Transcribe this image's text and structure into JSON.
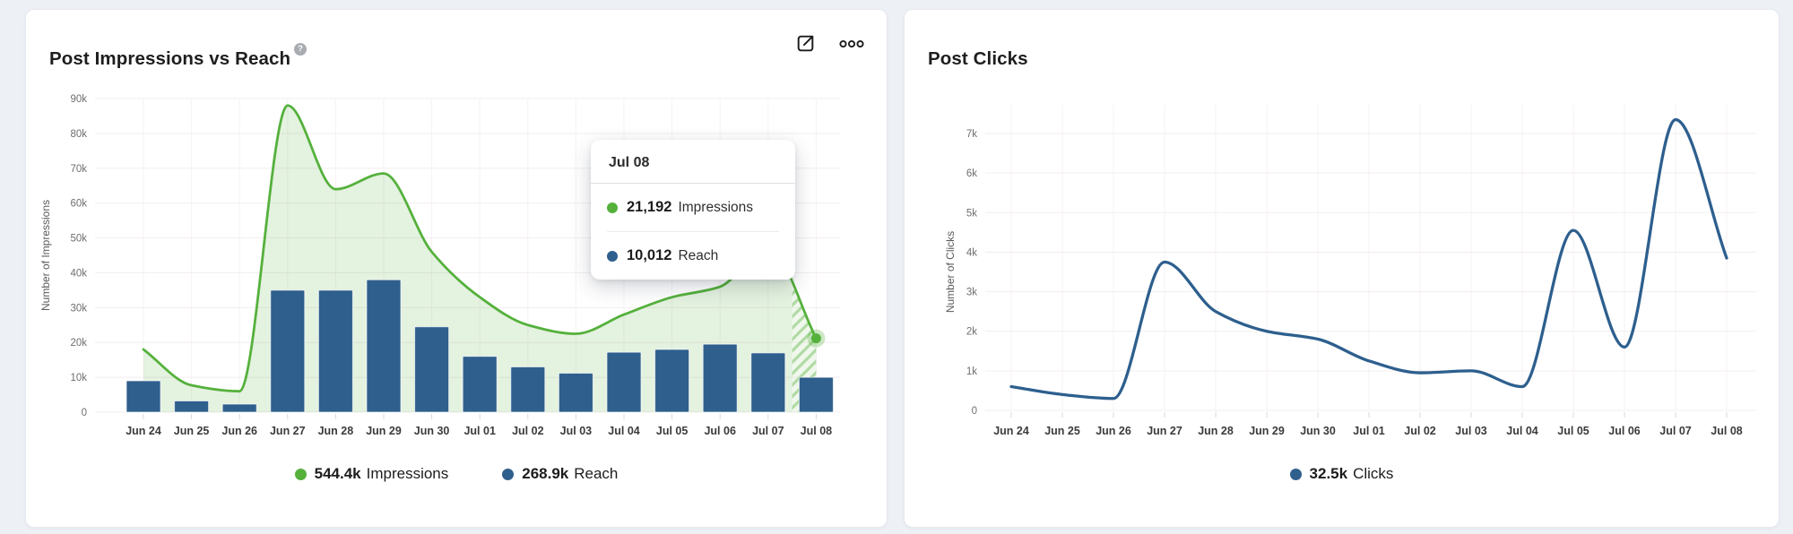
{
  "cards": {
    "impressions_reach": {
      "title": "Post Impressions vs Reach",
      "help_icon": "?",
      "legend": [
        {
          "color": "#55b13c",
          "value": "544.4k",
          "label": "Impressions"
        },
        {
          "color": "#2f5f8d",
          "value": "268.9k",
          "label": "Reach"
        }
      ],
      "tooltip": {
        "title": "Jul 08",
        "rows": [
          {
            "color": "#55b13c",
            "value": "21,192",
            "label": "Impressions"
          },
          {
            "color": "#2f5f8d",
            "value": "10,012",
            "label": "Reach"
          }
        ]
      }
    },
    "clicks": {
      "title": "Post Clicks",
      "legend": [
        {
          "color": "#2f5f8d",
          "value": "32.5k",
          "label": "Clicks"
        }
      ]
    }
  },
  "chart_data": [
    {
      "type": "area",
      "title": "Post Impressions vs Reach",
      "categories": [
        "Jun 24",
        "Jun 25",
        "Jun 26",
        "Jun 27",
        "Jun 28",
        "Jun 29",
        "Jun 30",
        "Jul 01",
        "Jul 02",
        "Jul 03",
        "Jul 04",
        "Jul 05",
        "Jul 06",
        "Jul 07",
        "Jul 08"
      ],
      "series": [
        {
          "name": "Impressions",
          "type": "area-line",
          "color": "#55b13c",
          "values": [
            18000,
            7700,
            6000,
            88000,
            64000,
            68500,
            46000,
            33000,
            25000,
            22500,
            28000,
            33000,
            36000,
            47500,
            21192
          ],
          "total": "544.4k",
          "last_point_marker": true,
          "last_segment_hatched": true
        },
        {
          "name": "Reach",
          "type": "bar",
          "color": "#2f5f8d",
          "values": [
            9000,
            3200,
            2300,
            35000,
            35000,
            38000,
            24500,
            16000,
            13000,
            11200,
            17200,
            18000,
            19500,
            17000,
            10012
          ],
          "total": "268.9k"
        }
      ],
      "xlabel": "",
      "ylabel": "Number of Impressions",
      "ylim": [
        0,
        90000
      ],
      "ytick_step": 10000,
      "ytick_labels": [
        "0",
        "10k",
        "20k",
        "30k",
        "40k",
        "50k",
        "60k",
        "70k",
        "80k",
        "90k"
      ],
      "grid": true,
      "legend_position": "bottom",
      "tooltip_point": {
        "category": "Jul 08",
        "Impressions": 21192,
        "Reach": 10012
      }
    },
    {
      "type": "line",
      "title": "Post Clicks",
      "categories": [
        "Jun 24",
        "Jun 25",
        "Jun 26",
        "Jun 27",
        "Jun 28",
        "Jun 29",
        "Jun 30",
        "Jul 01",
        "Jul 02",
        "Jul 03",
        "Jul 04",
        "Jul 05",
        "Jul 06",
        "Jul 07",
        "Jul 08"
      ],
      "series": [
        {
          "name": "Clicks",
          "type": "line",
          "color": "#2d5f8e",
          "values": [
            600,
            400,
            300,
            3750,
            2500,
            2000,
            1800,
            1250,
            950,
            1000,
            600,
            4550,
            1600,
            7350,
            3850
          ],
          "total": "32.5k"
        }
      ],
      "xlabel": "",
      "ylabel": "Number of Clicks",
      "ylim": [
        0,
        7000
      ],
      "ytick_step": 1000,
      "ytick_labels": [
        "0",
        "1k",
        "2k",
        "3k",
        "4k",
        "5k",
        "6k",
        "7k"
      ],
      "grid": true,
      "legend_position": "bottom"
    }
  ]
}
